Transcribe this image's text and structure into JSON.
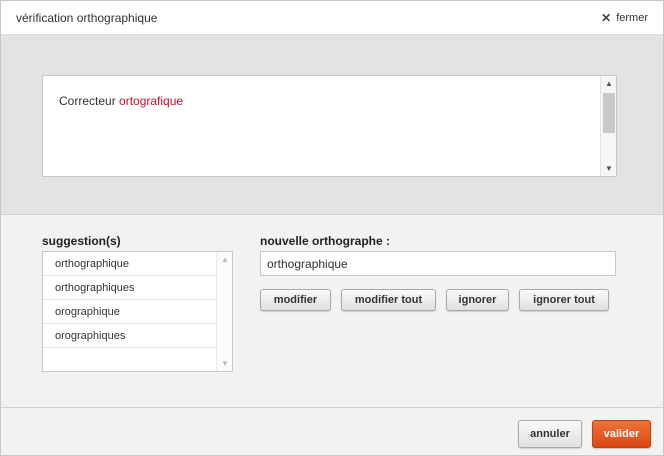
{
  "dialog": {
    "title": "vérification orthographique",
    "close_label": "fermer"
  },
  "text_area": {
    "prefix": "Correcteur ",
    "misspelled_word": "ortografique"
  },
  "suggestions": {
    "label": "suggestion(s)",
    "items": [
      "orthographique",
      "orthographiques",
      "orographique",
      "orographiques"
    ]
  },
  "new_spelling": {
    "label": "nouvelle orthographe :",
    "value": "orthographique"
  },
  "actions": {
    "modifier": "modifier",
    "modifier_tout": "modifier tout",
    "ignorer": "ignorer",
    "ignorer_tout": "ignorer tout"
  },
  "footer": {
    "annuler": "annuler",
    "valider": "valider"
  },
  "colors": {
    "misspelled": "#c8102e",
    "primary_button": "#e65a1c"
  }
}
